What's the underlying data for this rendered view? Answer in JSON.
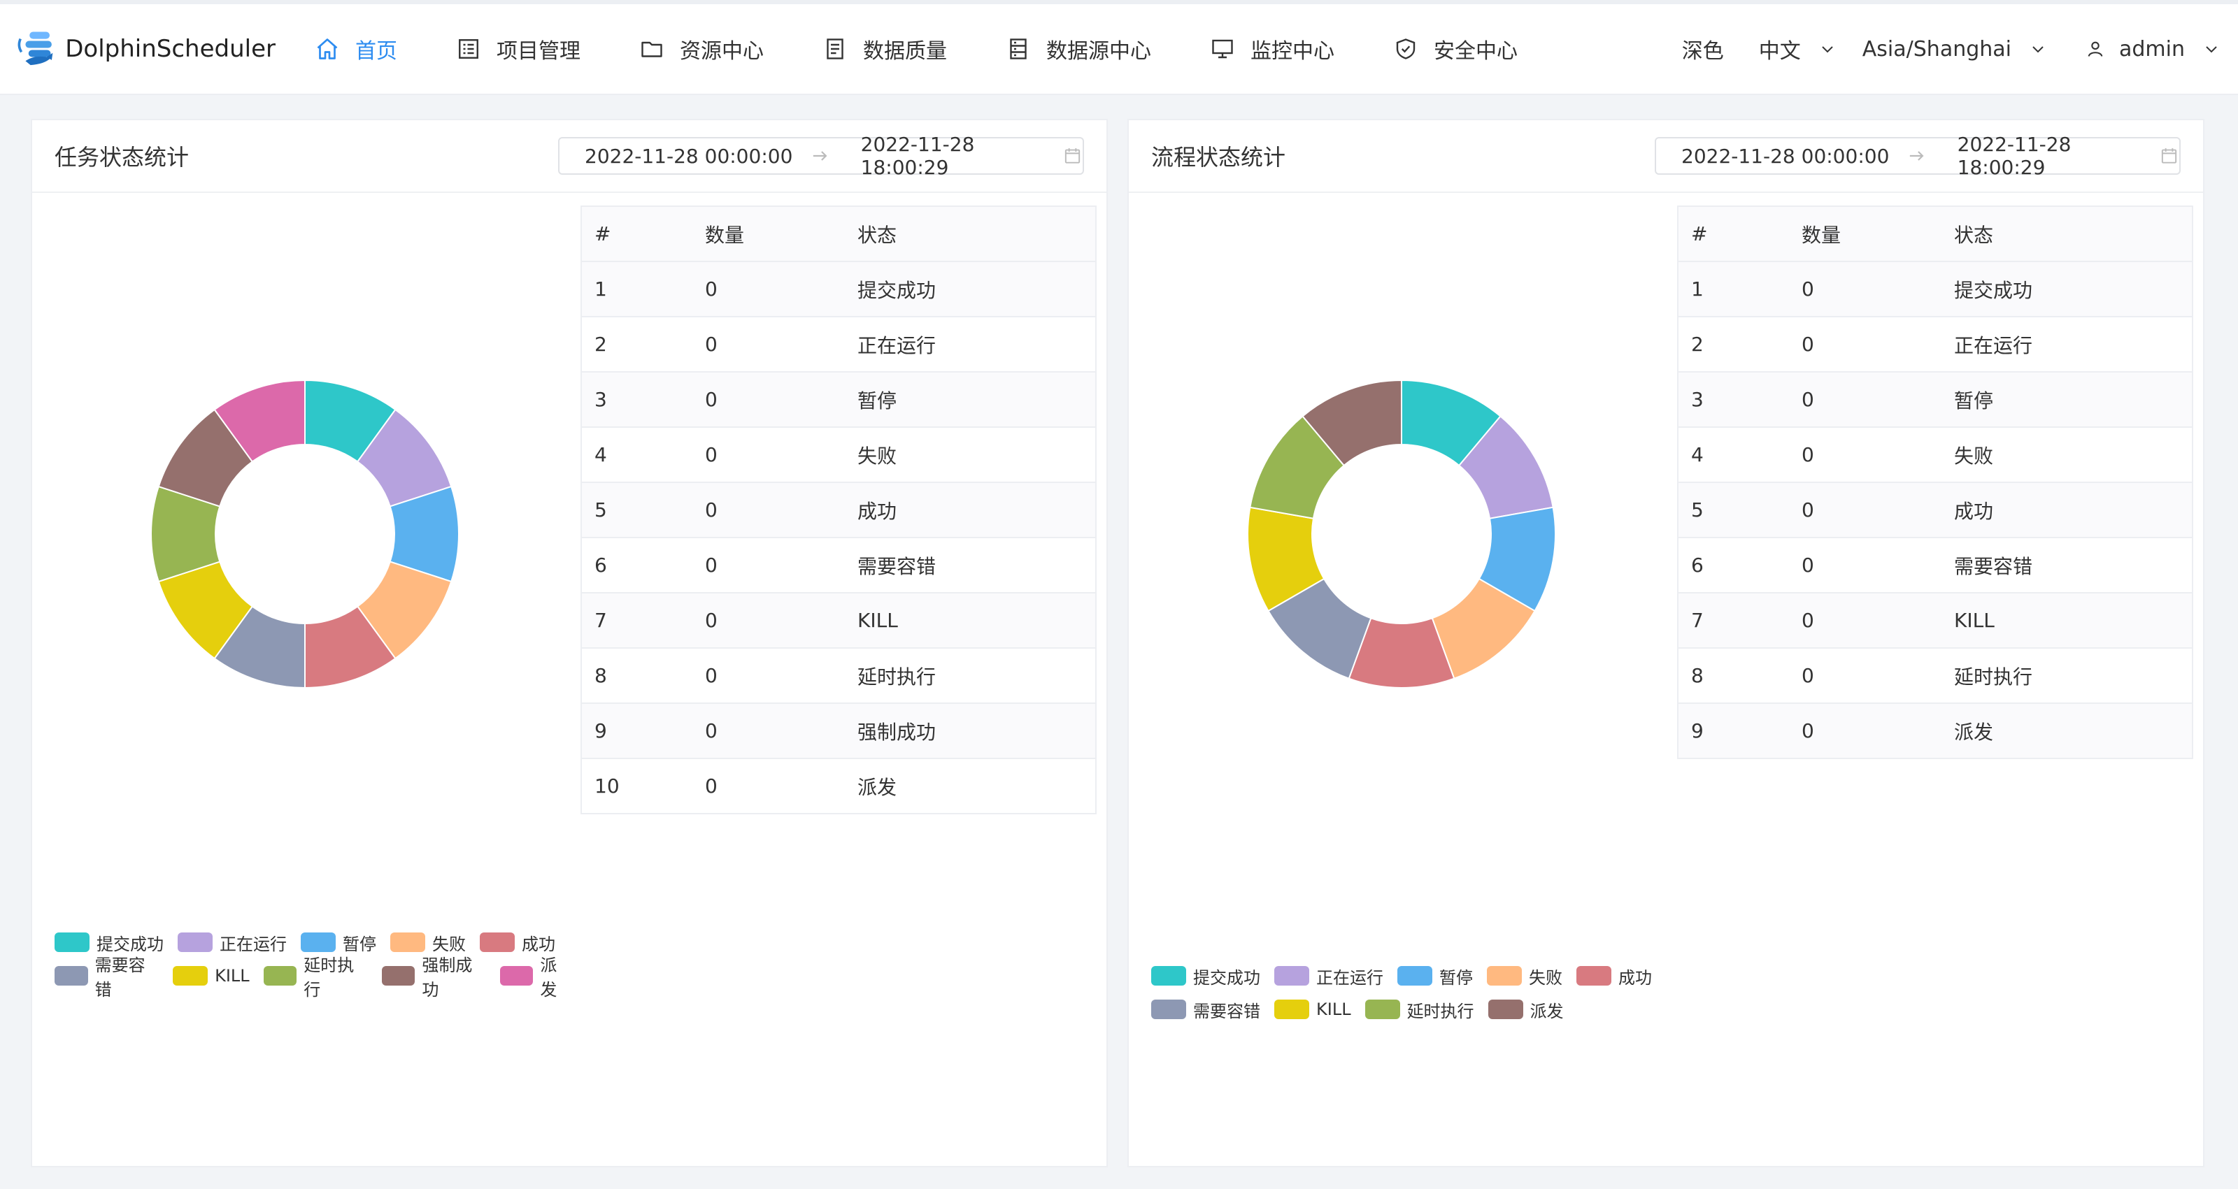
{
  "app": {
    "name": "DolphinScheduler"
  },
  "nav": [
    {
      "label": "首页",
      "icon": "home-icon",
      "active": true
    },
    {
      "label": "项目管理",
      "icon": "list-icon"
    },
    {
      "label": "资源中心",
      "icon": "folder-icon"
    },
    {
      "label": "数据质量",
      "icon": "document-icon"
    },
    {
      "label": "数据源中心",
      "icon": "database-icon"
    },
    {
      "label": "监控中心",
      "icon": "monitor-icon"
    },
    {
      "label": "安全中心",
      "icon": "shield-icon"
    }
  ],
  "header": {
    "theme": "深色",
    "language": "中文",
    "timezone": "Asia/Shanghai",
    "user": "admin"
  },
  "colors": {
    "accent": "#2d8cf0",
    "states": [
      "#2ec7c9",
      "#b6a2de",
      "#5ab1ef",
      "#ffb980",
      "#d87a80",
      "#8d98b3",
      "#e5cf0d",
      "#97b552",
      "#95706d",
      "#dc69aa"
    ]
  },
  "task_panel": {
    "title": "任务状态统计",
    "range_start": "2022-11-28 00:00:00",
    "range_end": "2022-11-28 18:00:29",
    "columns": [
      "#",
      "数量",
      "状态"
    ],
    "rows": [
      [
        "1",
        "0",
        "提交成功"
      ],
      [
        "2",
        "0",
        "正在运行"
      ],
      [
        "3",
        "0",
        "暂停"
      ],
      [
        "4",
        "0",
        "失败"
      ],
      [
        "5",
        "0",
        "成功"
      ],
      [
        "6",
        "0",
        "需要容错"
      ],
      [
        "7",
        "0",
        "KILL"
      ],
      [
        "8",
        "0",
        "延时执行"
      ],
      [
        "9",
        "0",
        "强制成功"
      ],
      [
        "10",
        "0",
        "派发"
      ]
    ],
    "legend": [
      "提交成功",
      "正在运行",
      "暂停",
      "失败",
      "成功",
      "需要容错",
      "KILL",
      "延时执行",
      "强制成功",
      "派发"
    ]
  },
  "process_panel": {
    "title": "流程状态统计",
    "range_start": "2022-11-28 00:00:00",
    "range_end": "2022-11-28 18:00:29",
    "columns": [
      "#",
      "数量",
      "状态"
    ],
    "rows": [
      [
        "1",
        "0",
        "提交成功"
      ],
      [
        "2",
        "0",
        "正在运行"
      ],
      [
        "3",
        "0",
        "暂停"
      ],
      [
        "4",
        "0",
        "失败"
      ],
      [
        "5",
        "0",
        "成功"
      ],
      [
        "6",
        "0",
        "需要容错"
      ],
      [
        "7",
        "0",
        "KILL"
      ],
      [
        "8",
        "0",
        "延时执行"
      ],
      [
        "9",
        "0",
        "派发"
      ]
    ],
    "legend": [
      "提交成功",
      "正在运行",
      "暂停",
      "失败",
      "成功",
      "需要容错",
      "KILL",
      "延时执行",
      "派发"
    ]
  },
  "chart_data": [
    {
      "type": "pie",
      "categories": [
        "提交成功",
        "正在运行",
        "暂停",
        "失败",
        "成功",
        "需要容错",
        "KILL",
        "延时执行",
        "强制成功",
        "派发"
      ],
      "values": [
        0,
        0,
        0,
        0,
        0,
        0,
        0,
        0,
        0,
        0
      ]
    },
    {
      "type": "pie",
      "categories": [
        "提交成功",
        "正在运行",
        "暂停",
        "失败",
        "成功",
        "需要容错",
        "KILL",
        "延时执行",
        "派发"
      ],
      "values": [
        0,
        0,
        0,
        0,
        0,
        0,
        0,
        0,
        0
      ]
    }
  ]
}
